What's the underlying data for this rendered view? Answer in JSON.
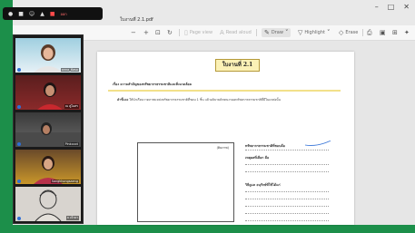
{
  "tab": {
    "title": "ใบงานที่ 2.1.pdf"
  },
  "toolbar": {
    "zoom_out": "−",
    "zoom_in": "+",
    "fit_icon": "fit-page-icon",
    "rotate_icon": "rotate-icon",
    "page_view": "Page view",
    "read_aloud": "Read aloud",
    "draw": "Draw",
    "highlight": "Highlight",
    "erase": "Erase"
  },
  "meeting": {
    "leave_label": "ออก"
  },
  "participants": [
    {
      "name": "anna_6aso"
    },
    {
      "name": "ณ คู่ไอสร"
    },
    {
      "name": "Pinkxxxt"
    },
    {
      "name": "Sangkhongsaeng"
    },
    {
      "name": "ธ เจ้าธา"
    }
  ],
  "document": {
    "title": "ใบงานที่ 2.1",
    "topic": "เรื่อง ความสำคัญของทรัพยากรธรรมชาติและสิ่งแวดล้อม",
    "instruction_label": "คำชี้แจง",
    "instruction": "ให้นักเรียนวาดภาพแหล่งทรัพยากรธรรมชาติที่ชอบ 1 ชิ้น แล้วอธิบายลักษณะของทรัพยากรธรรมชาติที่มีในแหล่งนั้น",
    "drawbox_label": "(ติดภาพ)",
    "questions": [
      "ทรัพยากรธรรมชาติที่ชอบคือ",
      "เหตุผลที่เลือก คือ",
      "วิธีดูแล อนุรักษ์ที่ใช้ได้แก่"
    ]
  },
  "colors": {
    "title_fill": "#fbf1b6",
    "title_border": "#b59a3a",
    "accent_green": "#1c8f4a",
    "ink_blue": "#2f6fd6"
  }
}
